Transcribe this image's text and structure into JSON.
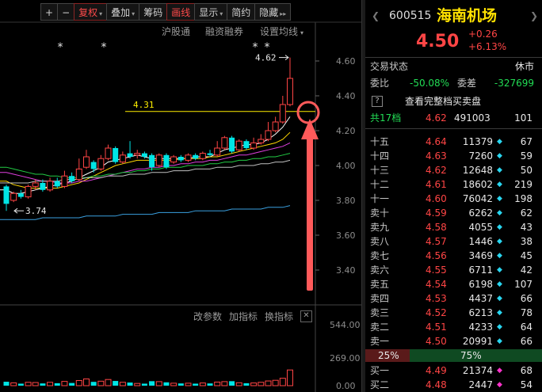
{
  "toolbar": {
    "items": [
      {
        "label": "+",
        "name": "zoom-in-button"
      },
      {
        "label": "−",
        "name": "zoom-out-button"
      },
      {
        "label": "复权",
        "name": "restore-rights-dropdown",
        "caret": "▾",
        "active": true
      },
      {
        "label": "叠加",
        "name": "overlay-dropdown",
        "caret": "▾"
      },
      {
        "label": "筹码",
        "name": "chips-button"
      },
      {
        "label": "画线",
        "name": "draw-line-button",
        "active": true
      },
      {
        "label": "显示",
        "name": "display-dropdown",
        "caret": "▾"
      },
      {
        "label": "简约",
        "name": "simple-mode-button"
      },
      {
        "label": "隐藏",
        "name": "hide-button",
        "caret": "▸▸"
      }
    ]
  },
  "subbar": {
    "shanghai_connect": "沪股通",
    "margin_trading": "融资融券",
    "set_ma": "设置均线",
    "caret": "▾"
  },
  "indicator_bar": {
    "params": "改参数",
    "add": "加指标",
    "swap": "换指标",
    "close": "✕"
  },
  "chart_data": {
    "type": "candlestick",
    "price_axis_ticks": [
      "4.60",
      "4.40",
      "4.20",
      "4.00",
      "3.80",
      "3.60",
      "3.40"
    ],
    "price_ylim": [
      3.3,
      4.72
    ],
    "volume_axis_ticks": [
      "544.00",
      "269.00",
      "0.00"
    ],
    "volume_ylim": [
      0,
      544
    ],
    "annotations": {
      "high_label": "4.62",
      "low_label": "3.74",
      "level_label": "4.31",
      "star_marker": "*"
    },
    "level_line": 4.31,
    "candles": [
      {
        "o": 3.88,
        "c": 3.78,
        "h": 3.89,
        "l": 3.74,
        "v": 35
      },
      {
        "o": 3.8,
        "c": 3.84,
        "h": 3.85,
        "l": 3.79,
        "v": 25
      },
      {
        "o": 3.84,
        "c": 3.82,
        "h": 3.86,
        "l": 3.81,
        "v": 18
      },
      {
        "o": 3.82,
        "c": 3.88,
        "h": 3.89,
        "l": 3.81,
        "v": 30
      },
      {
        "o": 3.88,
        "c": 3.9,
        "h": 3.92,
        "l": 3.86,
        "v": 28
      },
      {
        "o": 3.9,
        "c": 3.86,
        "h": 3.92,
        "l": 3.85,
        "v": 20
      },
      {
        "o": 3.86,
        "c": 3.91,
        "h": 3.93,
        "l": 3.85,
        "v": 30
      },
      {
        "o": 3.91,
        "c": 3.88,
        "h": 3.93,
        "l": 3.87,
        "v": 22
      },
      {
        "o": 3.88,
        "c": 3.94,
        "h": 3.97,
        "l": 3.87,
        "v": 38
      },
      {
        "o": 3.94,
        "c": 3.91,
        "h": 3.96,
        "l": 3.9,
        "v": 24
      },
      {
        "o": 3.92,
        "c": 3.98,
        "h": 4.04,
        "l": 3.91,
        "v": 46
      },
      {
        "o": 3.99,
        "c": 4.05,
        "h": 4.09,
        "l": 3.98,
        "v": 60
      },
      {
        "o": 4.02,
        "c": 3.98,
        "h": 4.03,
        "l": 3.96,
        "v": 34
      },
      {
        "o": 3.98,
        "c": 4.04,
        "h": 4.06,
        "l": 3.97,
        "v": 40
      },
      {
        "o": 4.04,
        "c": 4.1,
        "h": 4.12,
        "l": 4.03,
        "v": 55
      },
      {
        "o": 4.1,
        "c": 4.02,
        "h": 4.11,
        "l": 4.01,
        "v": 42
      },
      {
        "o": 4.02,
        "c": 4.06,
        "h": 4.08,
        "l": 4.01,
        "v": 30
      },
      {
        "o": 4.07,
        "c": 4.05,
        "h": 4.14,
        "l": 4.04,
        "v": 28
      },
      {
        "o": 4.06,
        "c": 4.07,
        "h": 4.09,
        "l": 4.04,
        "v": 20
      },
      {
        "o": 4.07,
        "c": 4.05,
        "h": 4.08,
        "l": 4.04,
        "v": 18
      },
      {
        "o": 4.06,
        "c": 3.99,
        "h": 4.07,
        "l": 3.97,
        "v": 40
      },
      {
        "o": 4.0,
        "c": 4.06,
        "h": 4.07,
        "l": 3.99,
        "v": 36
      },
      {
        "o": 4.06,
        "c": 3.99,
        "h": 4.07,
        "l": 3.98,
        "v": 30
      },
      {
        "o": 4.02,
        "c": 4.05,
        "h": 4.06,
        "l": 4.01,
        "v": 22
      },
      {
        "o": 4.05,
        "c": 4.03,
        "h": 4.06,
        "l": 4.02,
        "v": 20
      },
      {
        "o": 4.03,
        "c": 4.06,
        "h": 4.07,
        "l": 4.02,
        "v": 22
      },
      {
        "o": 4.06,
        "c": 4.04,
        "h": 4.07,
        "l": 4.03,
        "v": 18
      },
      {
        "o": 4.04,
        "c": 4.07,
        "h": 4.08,
        "l": 4.03,
        "v": 24
      },
      {
        "o": 4.07,
        "c": 4.06,
        "h": 4.09,
        "l": 4.05,
        "v": 20
      },
      {
        "o": 4.06,
        "c": 4.1,
        "h": 4.14,
        "l": 4.05,
        "v": 32
      },
      {
        "o": 4.1,
        "c": 4.16,
        "h": 4.17,
        "l": 4.09,
        "v": 36
      },
      {
        "o": 4.16,
        "c": 4.08,
        "h": 4.17,
        "l": 4.07,
        "v": 40
      },
      {
        "o": 4.09,
        "c": 4.14,
        "h": 4.15,
        "l": 4.08,
        "v": 26
      },
      {
        "o": 4.14,
        "c": 4.1,
        "h": 4.15,
        "l": 4.09,
        "v": 22
      },
      {
        "o": 4.1,
        "c": 4.13,
        "h": 4.16,
        "l": 4.09,
        "v": 24
      },
      {
        "o": 4.13,
        "c": 4.15,
        "h": 4.18,
        "l": 4.12,
        "v": 30
      },
      {
        "o": 4.15,
        "c": 4.2,
        "h": 4.25,
        "l": 4.14,
        "v": 42
      },
      {
        "o": 4.2,
        "c": 4.25,
        "h": 4.28,
        "l": 4.19,
        "v": 48
      },
      {
        "o": 4.25,
        "c": 4.35,
        "h": 4.4,
        "l": 4.24,
        "v": 66
      },
      {
        "o": 4.35,
        "c": 4.5,
        "h": 4.62,
        "l": 4.34,
        "v": 140
      }
    ],
    "ma_series": [
      {
        "color": "#ffffff",
        "values": [
          3.86,
          3.84,
          3.84,
          3.85,
          3.86,
          3.87,
          3.88,
          3.89,
          3.9,
          3.91,
          3.93,
          3.95,
          3.97,
          3.99,
          4.02,
          4.03,
          4.04,
          4.05,
          4.06,
          4.05,
          4.04,
          4.04,
          4.04,
          4.04,
          4.04,
          4.04,
          4.05,
          4.05,
          4.05,
          4.07,
          4.09,
          4.1,
          4.11,
          4.12,
          4.12,
          4.13,
          4.15,
          4.18,
          4.22,
          4.28
        ]
      },
      {
        "color": "#ffd700",
        "values": [
          3.91,
          3.89,
          3.88,
          3.87,
          3.87,
          3.87,
          3.87,
          3.87,
          3.88,
          3.89,
          3.9,
          3.92,
          3.94,
          3.96,
          3.98,
          4.0,
          4.01,
          4.02,
          4.03,
          4.03,
          4.03,
          4.03,
          4.03,
          4.03,
          4.04,
          4.04,
          4.04,
          4.04,
          4.05,
          4.05,
          4.06,
          4.07,
          4.08,
          4.09,
          4.1,
          4.11,
          4.12,
          4.13,
          4.15,
          4.19
        ]
      },
      {
        "color": "#e040e0",
        "values": [
          3.96,
          3.95,
          3.94,
          3.93,
          3.92,
          3.91,
          3.91,
          3.9,
          3.9,
          3.9,
          3.91,
          3.91,
          3.92,
          3.93,
          3.94,
          3.95,
          3.96,
          3.97,
          3.98,
          3.98,
          3.99,
          3.99,
          4.0,
          4.0,
          4.01,
          4.01,
          4.02,
          4.02,
          4.03,
          4.03,
          4.04,
          4.05,
          4.06,
          4.06,
          4.07,
          4.08,
          4.09,
          4.1,
          4.11,
          4.13
        ]
      },
      {
        "color": "#22cc44",
        "values": [
          3.99,
          3.98,
          3.97,
          3.96,
          3.95,
          3.95,
          3.94,
          3.94,
          3.93,
          3.93,
          3.93,
          3.93,
          3.94,
          3.94,
          3.95,
          3.95,
          3.96,
          3.96,
          3.97,
          3.97,
          3.98,
          3.98,
          3.99,
          3.99,
          3.99,
          4.0,
          4.0,
          4.0,
          4.01,
          4.01,
          4.02,
          4.02,
          4.03,
          4.03,
          4.04,
          4.04,
          4.05,
          4.05,
          4.06,
          4.07
        ]
      },
      {
        "color": "#c0c0c0",
        "values": [
          3.9,
          3.9,
          3.9,
          3.9,
          3.91,
          3.91,
          3.91,
          3.91,
          3.92,
          3.92,
          3.92,
          3.93,
          3.93,
          3.93,
          3.94,
          3.94,
          3.94,
          3.95,
          3.95,
          3.95,
          3.96,
          3.96,
          3.96,
          3.97,
          3.97,
          3.97,
          3.98,
          3.98,
          3.98,
          3.99,
          3.99,
          3.99,
          4.0,
          4.0,
          4.0,
          4.01,
          4.01,
          4.02,
          4.02,
          4.03
        ]
      },
      {
        "color": "#3aa0e0",
        "values": [
          3.69,
          3.69,
          3.69,
          3.69,
          3.69,
          3.7,
          3.7,
          3.7,
          3.7,
          3.7,
          3.7,
          3.71,
          3.71,
          3.71,
          3.71,
          3.71,
          3.72,
          3.72,
          3.72,
          3.72,
          3.72,
          3.73,
          3.73,
          3.73,
          3.73,
          3.73,
          3.74,
          3.74,
          3.74,
          3.74,
          3.74,
          3.75,
          3.75,
          3.75,
          3.75,
          3.75,
          3.76,
          3.76,
          3.76,
          3.77
        ]
      }
    ]
  },
  "quote": {
    "code": "600515",
    "name": "海南机场",
    "price": "4.50",
    "change": "+0.26",
    "change_pct": "+6.13%",
    "trade_status_label": "交易状态",
    "trade_status_value": "休市",
    "weibi_label": "委比",
    "weibi_value": "-50.08%",
    "weicha_label": "委差",
    "weicha_value": "-327699",
    "full_book_label": "查看完整档买卖盘",
    "full_book_icon": "?",
    "levels_label": "共17档",
    "levels_price": "4.62",
    "levels_volume": "491003",
    "levels_count": "101"
  },
  "asks": [
    {
      "label": "十五",
      "price": "4.64",
      "vol": "11379",
      "count": "67"
    },
    {
      "label": "十四",
      "price": "4.63",
      "vol": "7260",
      "count": "59"
    },
    {
      "label": "十三",
      "price": "4.62",
      "vol": "12648",
      "count": "50"
    },
    {
      "label": "十二",
      "price": "4.61",
      "vol": "18602",
      "count": "219"
    },
    {
      "label": "十一",
      "price": "4.60",
      "vol": "76042",
      "count": "198"
    },
    {
      "label": "卖十",
      "price": "4.59",
      "vol": "6262",
      "count": "62"
    },
    {
      "label": "卖九",
      "price": "4.58",
      "vol": "4055",
      "count": "43"
    },
    {
      "label": "卖八",
      "price": "4.57",
      "vol": "1446",
      "count": "38"
    },
    {
      "label": "卖七",
      "price": "4.56",
      "vol": "3469",
      "count": "45"
    },
    {
      "label": "卖六",
      "price": "4.55",
      "vol": "6711",
      "count": "42"
    },
    {
      "label": "卖五",
      "price": "4.54",
      "vol": "6198",
      "count": "107"
    },
    {
      "label": "卖四",
      "price": "4.53",
      "vol": "4437",
      "count": "66"
    },
    {
      "label": "卖三",
      "price": "4.52",
      "vol": "6213",
      "count": "78"
    },
    {
      "label": "卖二",
      "price": "4.51",
      "vol": "4233",
      "count": "64"
    },
    {
      "label": "卖一",
      "price": "4.50",
      "vol": "20991",
      "count": "66"
    }
  ],
  "ratio": {
    "sell": "25%",
    "buy": "75%",
    "sell_fraction": 0.25
  },
  "bids": [
    {
      "label": "买一",
      "price": "4.49",
      "vol": "21374",
      "count": "68"
    },
    {
      "label": "买二",
      "price": "4.48",
      "vol": "2447",
      "count": "54"
    }
  ],
  "colors": {
    "up": "#ff4545",
    "down": "#00e5e5",
    "level_line": "#ffee00",
    "annotation": "#ff5a5a"
  }
}
